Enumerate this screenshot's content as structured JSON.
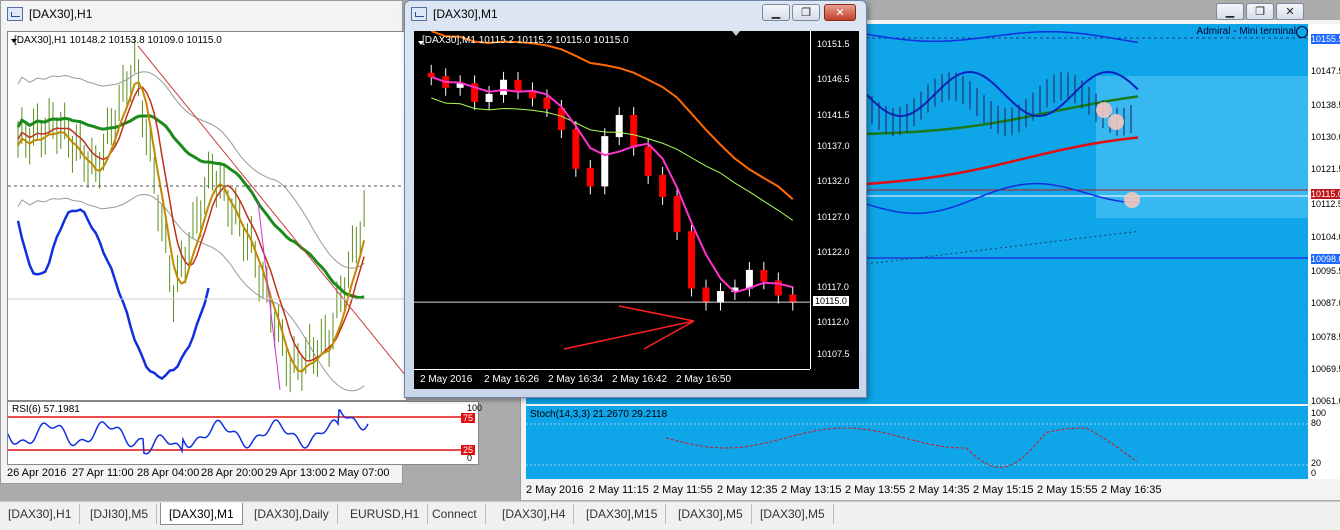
{
  "windows": {
    "h1": {
      "title": "[DAX30],H1",
      "info": "[DAX30],H1  10148.2 10153.8 10109.0 10115.0",
      "rsi_label": "RSI(6) 57.1981",
      "rsi_levels": [
        "100",
        "75",
        "25",
        "0"
      ],
      "x_ticks": [
        "26 Apr 2016",
        "27 Apr 11:00",
        "28 Apr 04:00",
        "28 Apr 20:00",
        "29 Apr 13:00",
        "2 May 07:00"
      ]
    },
    "m1": {
      "title": "[DAX30],M1",
      "info": "[DAX30],M1  10115.2 10115.2 10115.0 10115.0",
      "y_ticks": [
        "10151.5",
        "10146.5",
        "10141.5",
        "10137.0",
        "10132.0",
        "10127.0",
        "10122.0",
        "10117.0",
        "10112.0",
        "10107.5"
      ],
      "current_price": "10115.0",
      "x_ticks": [
        "2 May 2016",
        "2 May 16:26",
        "2 May 16:34",
        "2 May 16:42",
        "2 May 16:50"
      ]
    },
    "m5": {
      "label": "Admiral - Mini terminal",
      "stoch_label": "Stoch(14,3,3) 21.2670 29.2118",
      "y_ticks": [
        "10155.5",
        "10147.5",
        "10138.5",
        "10130.0",
        "10121.5",
        "10115.0",
        "10112.5",
        "10104.0",
        "10098.0",
        "10095.5",
        "10087.0",
        "10078.5",
        "10069.5",
        "10061.0"
      ],
      "stoch_levels": [
        "100",
        "80",
        "20",
        "0"
      ],
      "x_ticks": [
        "2 May 2016",
        "2 May 11:15",
        "2 May 11:55",
        "2 May 12:35",
        "2 May 13:15",
        "2 May 13:55",
        "2 May 14:35",
        "2 May 15:15",
        "2 May 15:55",
        "2 May 16:35"
      ]
    }
  },
  "tabs": [
    "[DAX30],H1",
    "[DJI30],M5",
    "[DAX30],M1",
    "[DAX30],Daily",
    "EURUSD,H1",
    "Connect",
    "[DAX30],H4",
    "[DAX30],M15",
    "[DAX30],M5",
    "[DAX30],M5"
  ],
  "active_tab": 2,
  "colors": {
    "bull_candle": "#ffffff",
    "bear_candle": "#ff0000",
    "m5_background": "#0ea5e9",
    "h1_background": "#ffffff",
    "m1_background": "#000000"
  },
  "chart_data": [
    {
      "type": "line",
      "title": "[DAX30],M1",
      "ylim": [
        10105.5,
        10153.5
      ],
      "x": [
        "2 May 2016",
        "2 May 16:26",
        "2 May 16:34",
        "2 May 16:42",
        "2 May 16:50"
      ],
      "series": [
        {
          "values": [
            10147.0,
            10145.5,
            10146.0,
            10143.5,
            10144.5,
            10146.5,
            10145.0,
            10144.0,
            10142.5,
            10139.5,
            10134.0,
            10131.5,
            10138.5,
            10141.5,
            10137.0,
            10133.0,
            10130.0,
            10125.0,
            10117.0,
            10115.0,
            10116.5,
            10117.0,
            10119.5,
            10118.0,
            10116.0,
            10115.0
          ]
        }
      ]
    },
    {
      "type": "line",
      "title": "[DAX30],H1",
      "ylim": [
        10050,
        10170
      ],
      "x": [
        "26 Apr 2016",
        "27 Apr 11:00",
        "28 Apr 04:00",
        "28 Apr 20:00",
        "29 Apr 13:00",
        "2 May 07:00"
      ],
      "series": [
        {
          "values": [
            10135,
            10140,
            10125,
            10160,
            10085,
            10125,
            10100,
            10060,
            10070,
            10115
          ]
        }
      ]
    }
  ]
}
